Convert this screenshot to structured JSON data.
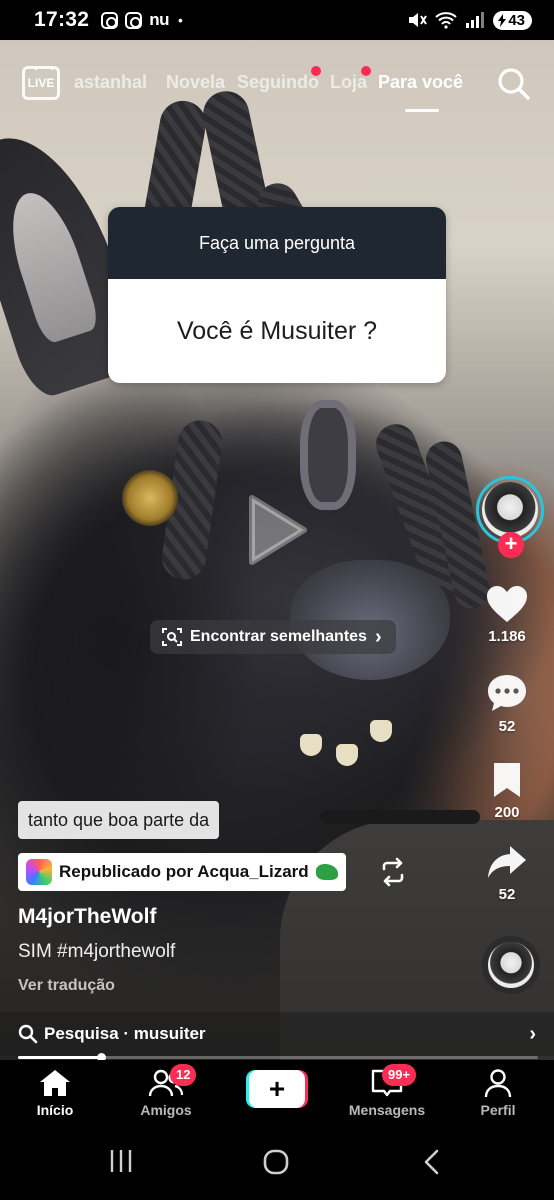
{
  "status_bar": {
    "time": "17:32",
    "app_icons": [
      "instagram-icon",
      "instagram-icon",
      "nubank-icon"
    ],
    "nu_label": "nu",
    "dot": "•",
    "battery": "43"
  },
  "top_nav": {
    "live_label": "LIVE",
    "tabs": [
      {
        "label": "astanhal",
        "active": false,
        "dot": false
      },
      {
        "label": "Novela",
        "active": false,
        "dot": false
      },
      {
        "label": "Seguindo",
        "active": false,
        "dot": true
      },
      {
        "label": "Loja",
        "active": false,
        "dot": true
      },
      {
        "label": "Para você",
        "active": true,
        "dot": false
      }
    ]
  },
  "question_sticker": {
    "header": "Faça uma pergunta",
    "question": "Você é Musuiter ?"
  },
  "find_similar": {
    "label": "Encontrar semelhantes",
    "chevron": "›"
  },
  "actions": {
    "follow": "+",
    "likes": "1.186",
    "comments": "52",
    "saves": "200",
    "shares": "52"
  },
  "caption_text": "tanto que boa parte da",
  "repost": {
    "label": "Republicado por Acqua_Lizard"
  },
  "post": {
    "username": "M4jorTheWolf",
    "description": "SIM #m4jorthewolf",
    "translate": "Ver tradução"
  },
  "search_suggestion": {
    "label": "Pesquisa · musuiter",
    "chevron": "›"
  },
  "progress": {
    "fraction": 0.16
  },
  "bottom_nav": {
    "home": "Início",
    "friends": "Amigos",
    "friends_badge": "12",
    "create": "+",
    "inbox": "Mensagens",
    "inbox_badge": "99+",
    "profile": "Perfil"
  },
  "colors": {
    "accent_red": "#fe2c55",
    "accent_cyan": "#25f4ee",
    "story_ring": "#29c4e0"
  }
}
